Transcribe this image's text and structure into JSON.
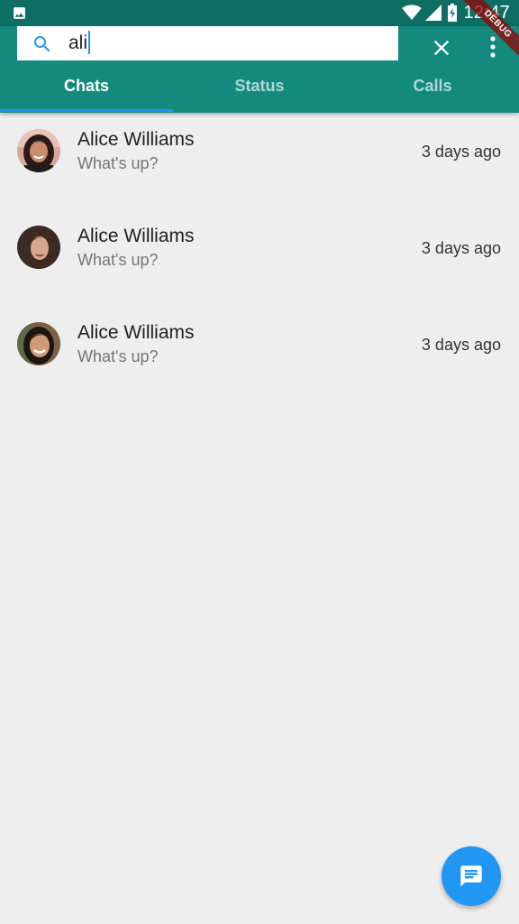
{
  "status_bar": {
    "time": "12:47",
    "icons": [
      "image-icon",
      "wifi-icon",
      "signal-icon",
      "battery-icon"
    ]
  },
  "debug_banner": "DEBUG",
  "search": {
    "value": "ali",
    "icons": [
      "search-icon",
      "close-icon",
      "more-vert-icon"
    ]
  },
  "tabs": [
    {
      "label": "Chats",
      "selected": true
    },
    {
      "label": "Status",
      "selected": false
    },
    {
      "label": "Calls",
      "selected": false
    }
  ],
  "chats": [
    {
      "name": "Alice Williams",
      "message": "What's up?",
      "time": "3 days ago"
    },
    {
      "name": "Alice Williams",
      "message": "What's up?",
      "time": "3 days ago"
    },
    {
      "name": "Alice Williams",
      "message": "What's up?",
      "time": "3 days ago"
    }
  ],
  "fab": {
    "icon": "message-icon"
  },
  "colors": {
    "status_bar": "#0f6e63",
    "app_bar": "#148a7e",
    "accent": "#2196f3",
    "background": "#eeeeee"
  }
}
